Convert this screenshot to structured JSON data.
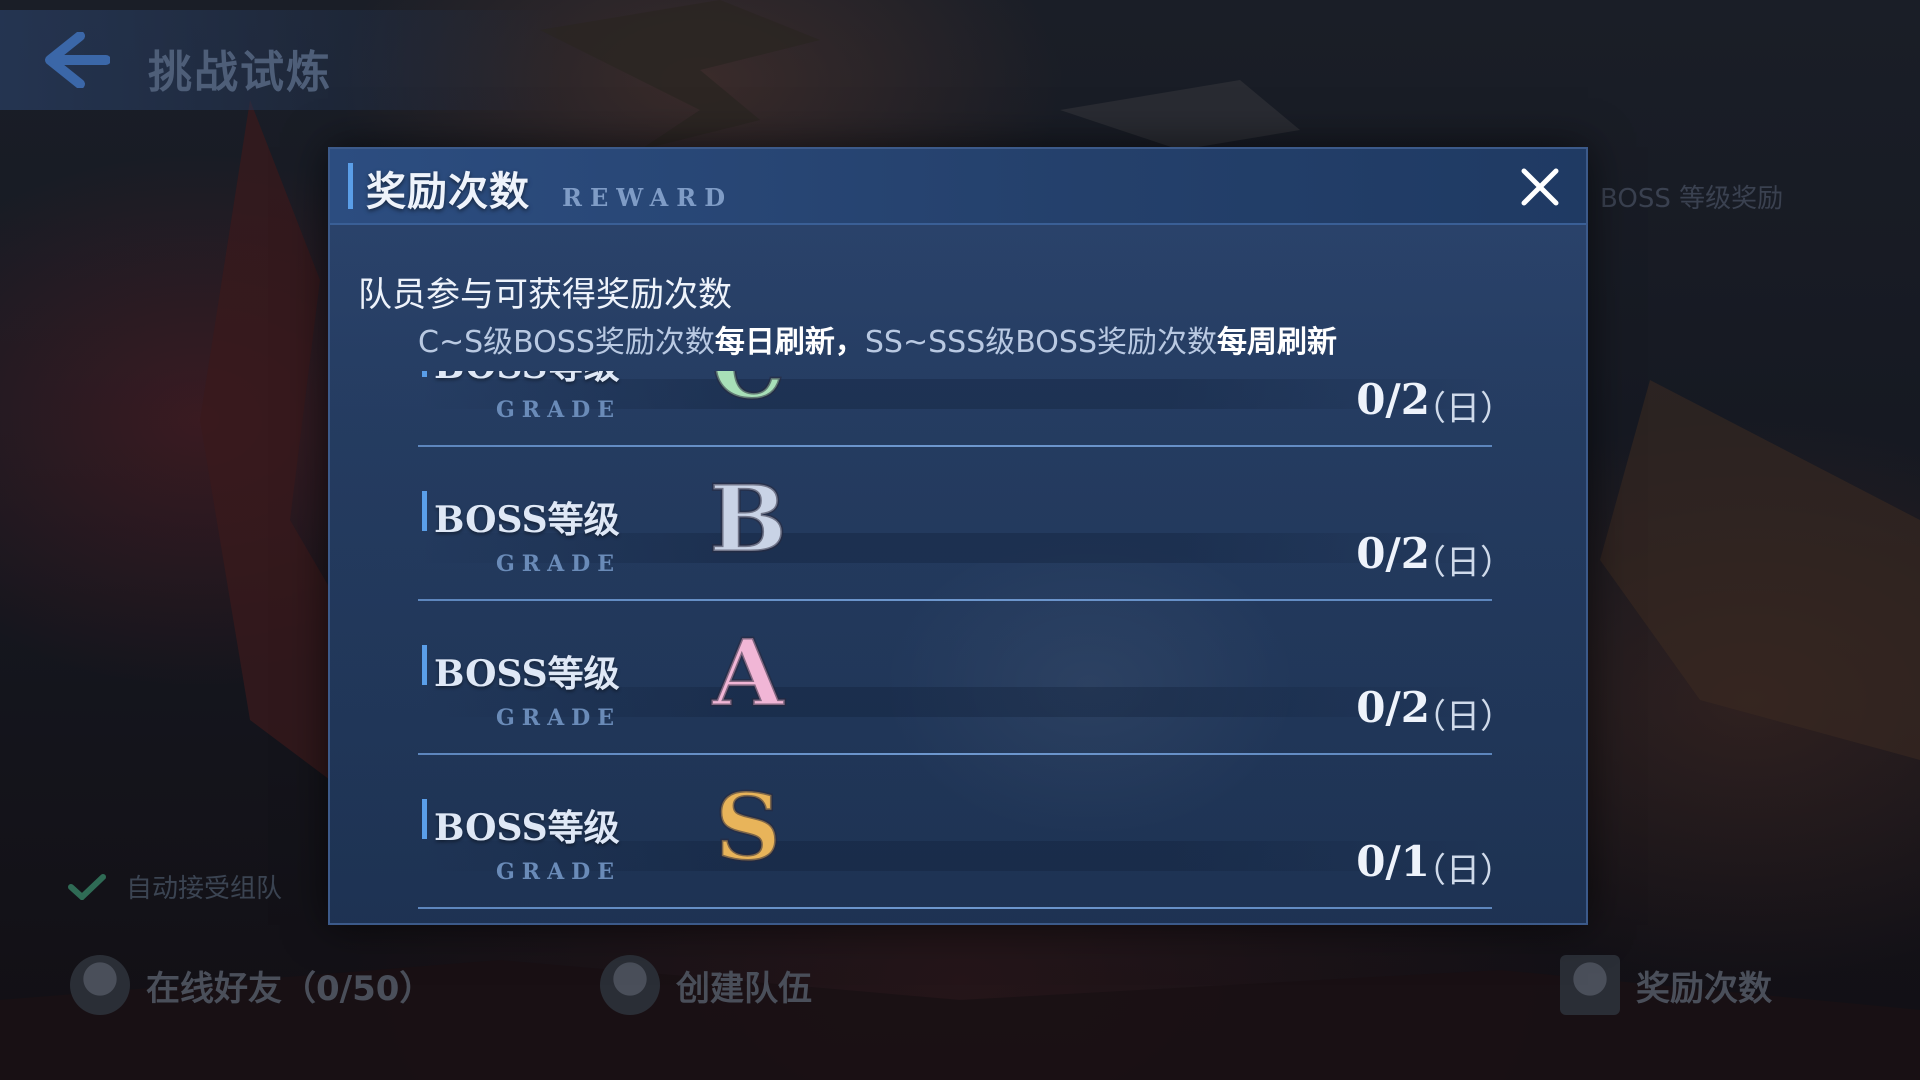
{
  "background": {
    "back_title": "挑战试炼",
    "top_right_text": "BOSS 等级奖励",
    "side_check_text": "自动接受组队",
    "bottom_items": [
      {
        "label": "在线好友（0/50）",
        "icon": "friends-icon"
      },
      {
        "label": "创建队伍",
        "icon": "team-icon"
      },
      {
        "label": "奖励次数",
        "icon": "reward-icon"
      }
    ]
  },
  "modal": {
    "title": "奖励次数",
    "subtitle": "REWARD",
    "close_icon": "close-icon",
    "description": {
      "title": "队员参与可获得奖励次数",
      "line_parts": [
        {
          "text": "C~S级BOSS奖励次数",
          "style": "muted"
        },
        {
          "text": "每日刷新，",
          "style": "strong"
        },
        {
          "text": "SS~SSS级BOSS奖励次数",
          "style": "muted"
        },
        {
          "text": "每周刷新",
          "style": "strong"
        }
      ]
    },
    "rows": [
      {
        "label": "BOSS等级",
        "sub": "GRADE",
        "grade": "C",
        "grade_color": "#a8e0b8",
        "count": "0/2",
        "period": "（日）"
      },
      {
        "label": "BOSS等级",
        "sub": "GRADE",
        "grade": "B",
        "grade_color": "#c9d3e6",
        "count": "0/2",
        "period": "（日）"
      },
      {
        "label": "BOSS等级",
        "sub": "GRADE",
        "grade": "A",
        "grade_color": "#f1b6d6",
        "count": "0/2",
        "period": "（日）"
      },
      {
        "label": "BOSS等级",
        "sub": "GRADE",
        "grade": "S",
        "grade_color": "#e8b45a",
        "count": "0/1",
        "period": "（日）"
      }
    ]
  },
  "colors": {
    "accent": "#5a9ee8",
    "modal_bg": "#223a60",
    "text_primary": "#eef3fb"
  }
}
